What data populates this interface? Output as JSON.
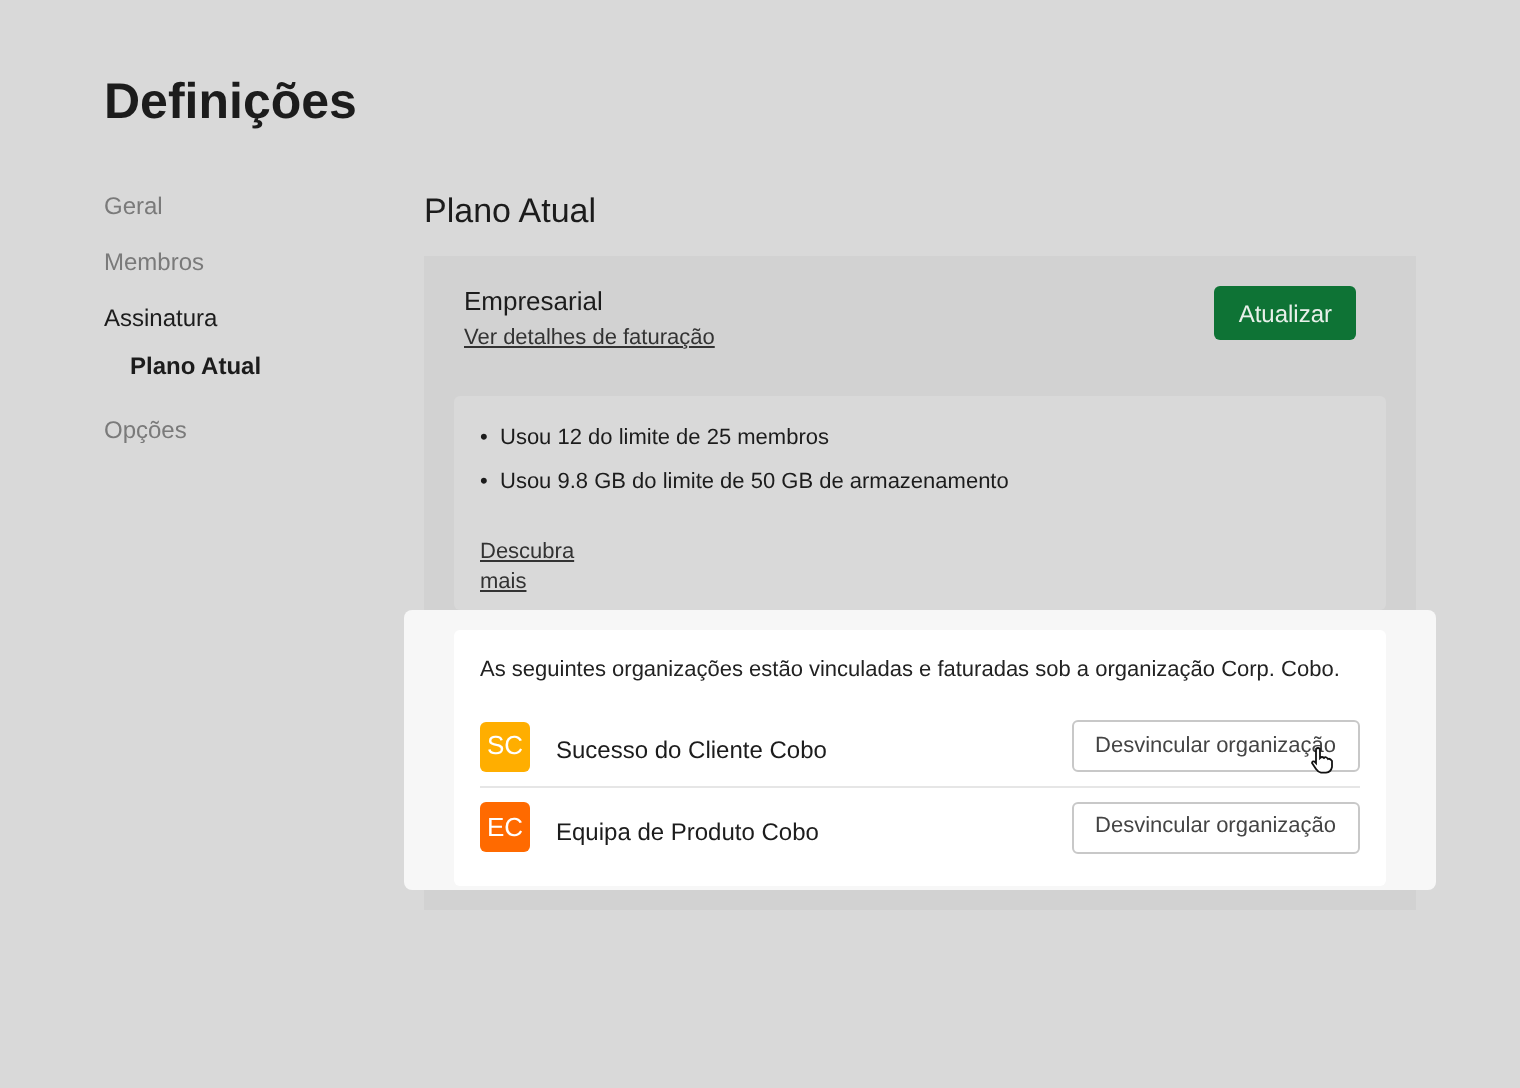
{
  "page_title": "Definições",
  "sidebar": {
    "items": [
      {
        "label": "Geral",
        "selected": false
      },
      {
        "label": "Membros",
        "selected": false
      },
      {
        "label": "Assinatura",
        "selected": true,
        "children": [
          {
            "label": "Plano Atual",
            "selected": true
          }
        ]
      },
      {
        "label": "Opções",
        "selected": false
      }
    ]
  },
  "section_title": "Plano Atual",
  "plan": {
    "name": "Empresarial",
    "billing_link": "Ver detalhes de faturação",
    "upgrade_button": "Atualizar"
  },
  "usage": [
    {
      "marker": "•",
      "text": "Usou 12 do limite de 25 membros"
    },
    {
      "marker": "•",
      "text": "Usou 9.8 GB do limite de 50 GB de armazenamento"
    }
  ],
  "learn_more_link": "Descubra mais",
  "linked_orgs": {
    "description": "As seguintes organizações estão vinculadas e faturadas sob a organização Corp. Cobo.",
    "items": [
      {
        "initials": "SC",
        "name": "Sucesso do Cliente Cobo",
        "color": "#ffae00",
        "button": "Desvincular organização",
        "hovered": true
      },
      {
        "initials": "EC",
        "name": "Equipa de Produto Cobo",
        "color": "#ff6a00",
        "button": "Desvincular organização",
        "hovered": false
      }
    ]
  }
}
